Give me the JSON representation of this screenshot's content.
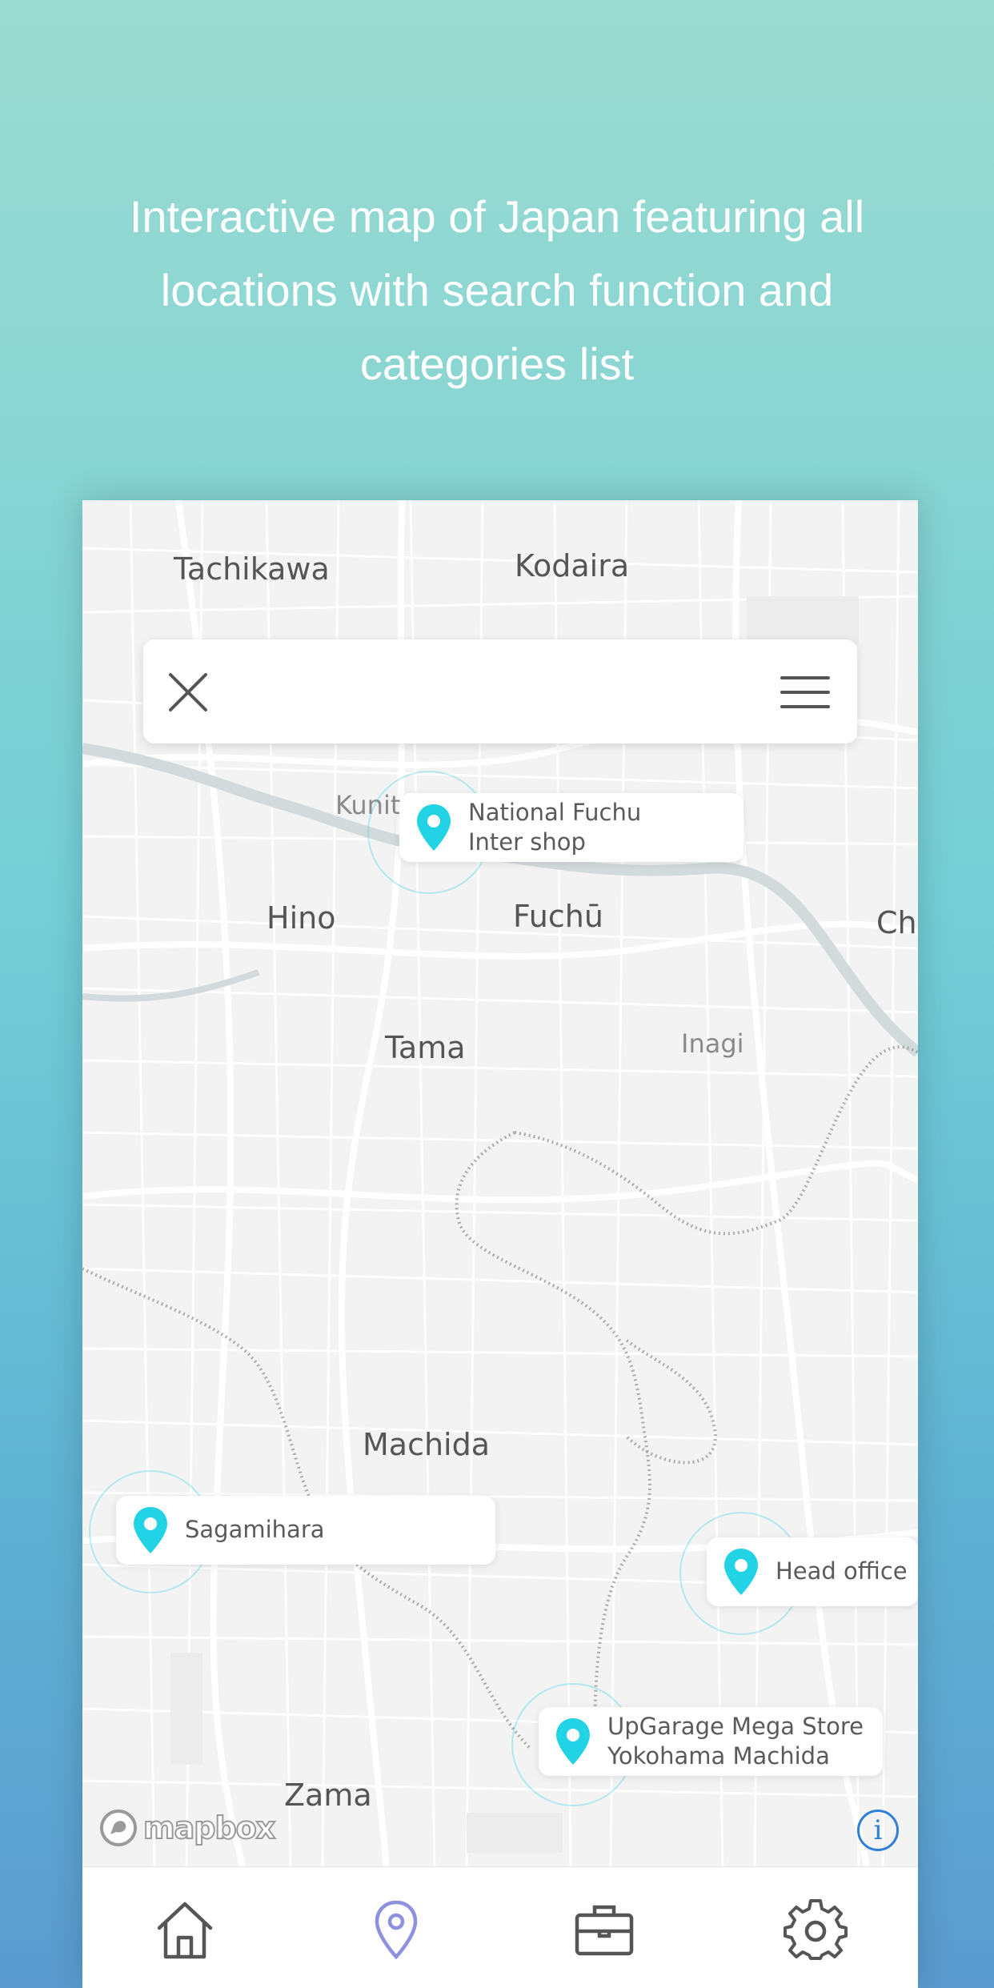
{
  "headline": "Interactive map of Japan featuring all locations with search function and categories list",
  "search": {
    "value": "",
    "placeholder": ""
  },
  "map": {
    "places": [
      "Tachikawa",
      "Kodaira",
      "Kunitachi",
      "Hino",
      "Fuchū",
      "Ch",
      "Tama",
      "Inagi",
      "Machida",
      "Zama"
    ],
    "attribution": "mapbox",
    "info_icon_glyph": "i"
  },
  "markers": [
    {
      "line1": "National Fuchu",
      "line2": "Inter shop"
    },
    {
      "line1": "Sagamihara",
      "line2": ""
    },
    {
      "line1": "Head office",
      "line2": ""
    },
    {
      "line1": "UpGarage Mega Store",
      "line2": "Yokohama Machida"
    }
  ],
  "tabs": [
    {
      "icon": "home-icon",
      "active": false
    },
    {
      "icon": "location-pin-icon",
      "active": true
    },
    {
      "icon": "briefcase-icon",
      "active": false
    },
    {
      "icon": "gear-icon",
      "active": false
    }
  ],
  "colors": {
    "accent_pin": "#22d3e6",
    "active_tab": "#8e90e0",
    "inactive_tab": "#555555",
    "info": "#2f7fd6"
  }
}
